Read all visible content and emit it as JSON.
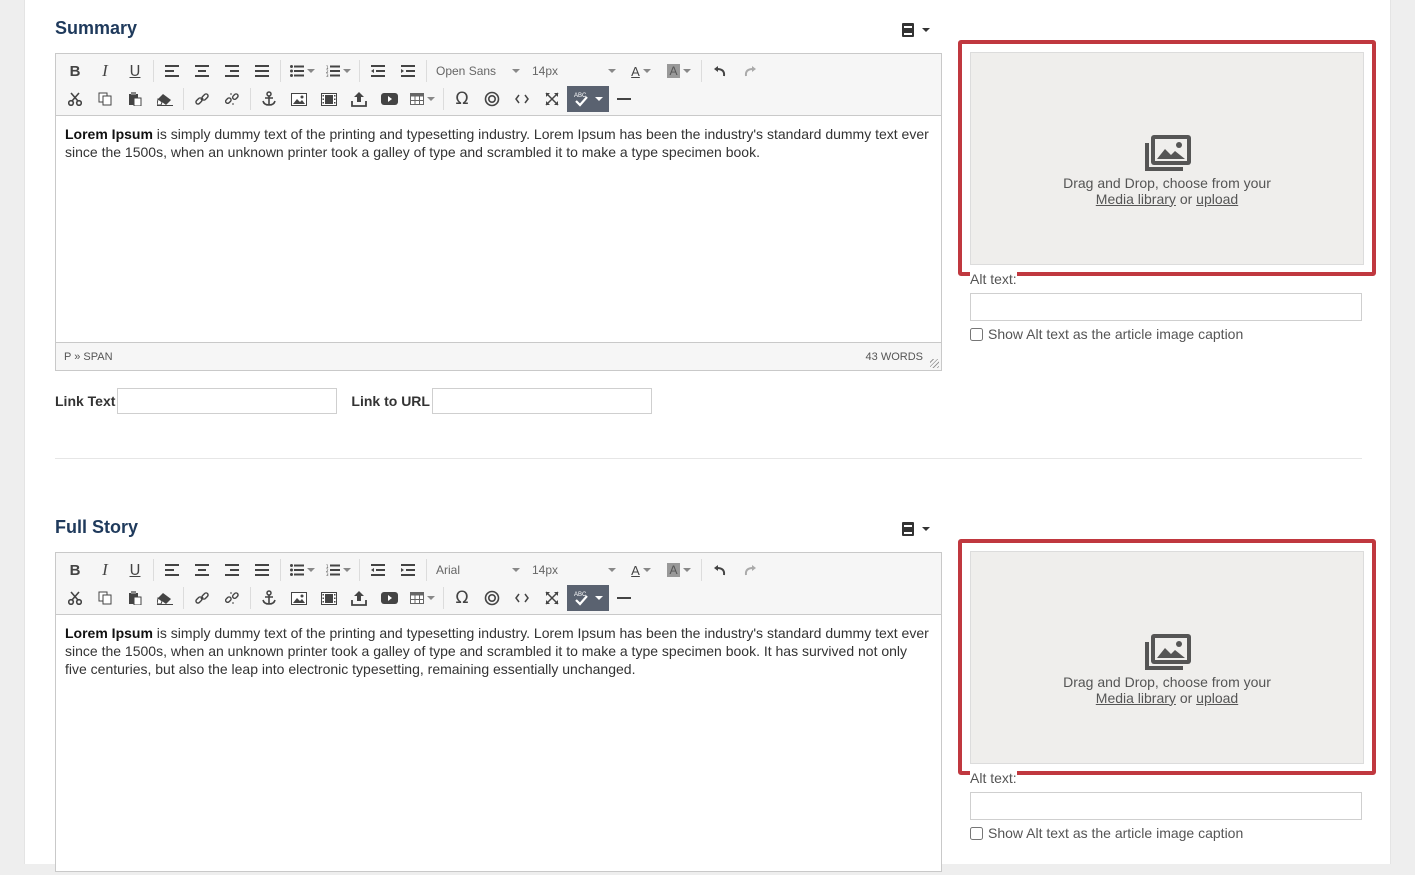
{
  "sections": [
    {
      "title": "Summary",
      "font": "Open Sans",
      "size": "14px",
      "content_bold": "Lorem Ipsum",
      "content_rest": " is simply dummy text of the printing and typesetting industry. Lorem Ipsum has been the industry's standard dummy text ever since the 1500s, when an unknown printer took a galley of type and scrambled it to make a type specimen book.",
      "path": "P » SPAN",
      "words": "43 WORDS"
    },
    {
      "title": "Full Story",
      "font": "Arial",
      "size": "14px",
      "content_bold": "Lorem Ipsum",
      "content_rest": " is simply dummy text of the printing and typesetting industry. Lorem Ipsum has been the industry's standard dummy text ever since the 1500s, when an unknown printer took a galley of type and scrambled it to make a type specimen book. It has survived not only five centuries, but also the leap into electronic typesetting, remaining essentially unchanged."
    }
  ],
  "link": {
    "text_label": "Link Text",
    "url_label": "Link to URL"
  },
  "media": {
    "drop_text": "Drag and Drop, choose from your",
    "library_link": "Media library",
    "or_text": "or",
    "upload_link": "upload",
    "alt_label": "Alt text:",
    "caption_label": "Show Alt text as the article image caption"
  },
  "icons": {
    "toolbar_row1": [
      "bold-icon",
      "italic-icon",
      "underline-icon",
      "align-left-icon",
      "align-center-icon",
      "align-right-icon",
      "align-justify-icon",
      "bulleted-list-icon",
      "numbered-list-icon",
      "outdent-icon",
      "indent-icon",
      "text-color-icon",
      "background-color-icon",
      "undo-icon",
      "redo-icon"
    ],
    "toolbar_row2": [
      "cut-icon",
      "copy-icon",
      "paste-icon",
      "eraser-icon",
      "link-icon",
      "unlink-icon",
      "anchor-icon",
      "image-icon",
      "video-icon",
      "upload-icon",
      "youtube-icon",
      "table-icon",
      "omega-icon",
      "target-icon",
      "code-icon",
      "fullscreen-icon",
      "spellcheck-icon",
      "horizontal-rule-icon"
    ],
    "template": "book-icon",
    "drop": "images-icon"
  },
  "colors": {
    "title": "#1f3a5c",
    "highlight_border": "#c0383f",
    "dropzone_bg": "#efeeec"
  }
}
